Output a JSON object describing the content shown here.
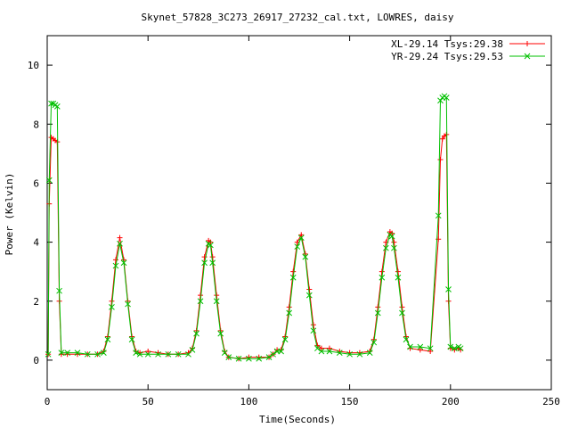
{
  "chart_data": {
    "type": "scatter",
    "title": "Skynet_57828_3C273_26917_27232_cal.txt, LOWRES, daisy",
    "xlabel": "Time(Seconds)",
    "ylabel": "Power (Kelvin)",
    "xlim": [
      0,
      250
    ],
    "ylim": [
      -1,
      11
    ],
    "xticks": [
      0,
      50,
      100,
      150,
      200,
      250
    ],
    "yticks": [
      0,
      2,
      4,
      6,
      8,
      10
    ],
    "grid": false,
    "legend_position": "top-right",
    "colors": {
      "XL": "#ff0000",
      "YR": "#00c000"
    },
    "series": [
      {
        "name": "XL-29.14 Tsys:29.38",
        "marker": "plus",
        "x": [
          0.5,
          1,
          2,
          3,
          4,
          5,
          6,
          7,
          10,
          15,
          20,
          25,
          28,
          30,
          32,
          34,
          36,
          38,
          40,
          42,
          44,
          46,
          50,
          55,
          60,
          65,
          70,
          72,
          74,
          76,
          78,
          80,
          81,
          82,
          84,
          86,
          88,
          90,
          95,
          100,
          105,
          110,
          112,
          114,
          116,
          118,
          120,
          122,
          124,
          126,
          128,
          130,
          132,
          134,
          136,
          140,
          145,
          150,
          155,
          160,
          162,
          164,
          166,
          168,
          170,
          171,
          172,
          174,
          176,
          178,
          180,
          185,
          190,
          194,
          195,
          196,
          197,
          198,
          199,
          200,
          202,
          204,
          205
        ],
        "y": [
          0.2,
          5.3,
          7.55,
          7.5,
          7.45,
          7.4,
          2.0,
          0.2,
          0.2,
          0.2,
          0.2,
          0.2,
          0.3,
          0.8,
          2.0,
          3.4,
          4.15,
          3.4,
          2.0,
          0.8,
          0.3,
          0.25,
          0.3,
          0.25,
          0.2,
          0.2,
          0.25,
          0.4,
          1.0,
          2.2,
          3.5,
          4.05,
          4.0,
          3.5,
          2.2,
          1.0,
          0.3,
          0.1,
          0.05,
          0.1,
          0.1,
          0.1,
          0.2,
          0.35,
          0.35,
          0.8,
          1.8,
          3.0,
          4.0,
          4.25,
          3.6,
          2.4,
          1.2,
          0.5,
          0.4,
          0.4,
          0.3,
          0.25,
          0.25,
          0.3,
          0.7,
          1.8,
          3.0,
          4.0,
          4.35,
          4.3,
          4.0,
          3.0,
          1.8,
          0.8,
          0.4,
          0.35,
          0.3,
          4.1,
          6.8,
          7.5,
          7.6,
          7.65,
          2.0,
          0.4,
          0.35,
          0.4,
          0.35
        ]
      },
      {
        "name": "YR-29.24 Tsys:29.53",
        "marker": "cross",
        "x": [
          0.5,
          1,
          2,
          3,
          4,
          5,
          6,
          7,
          10,
          15,
          20,
          25,
          28,
          30,
          32,
          34,
          36,
          38,
          40,
          42,
          44,
          46,
          50,
          55,
          60,
          65,
          70,
          72,
          74,
          76,
          78,
          80,
          81,
          82,
          84,
          86,
          88,
          90,
          95,
          100,
          105,
          110,
          112,
          114,
          116,
          118,
          120,
          122,
          124,
          126,
          128,
          130,
          132,
          134,
          136,
          140,
          145,
          150,
          155,
          160,
          162,
          164,
          166,
          168,
          170,
          171,
          172,
          174,
          176,
          178,
          180,
          185,
          190,
          194,
          195,
          196,
          197,
          198,
          199,
          200,
          202,
          204,
          205
        ],
        "y": [
          0.2,
          6.1,
          8.7,
          8.7,
          8.65,
          8.6,
          2.35,
          0.25,
          0.25,
          0.25,
          0.2,
          0.2,
          0.25,
          0.7,
          1.8,
          3.2,
          3.95,
          3.3,
          1.9,
          0.7,
          0.25,
          0.2,
          0.2,
          0.2,
          0.2,
          0.2,
          0.2,
          0.35,
          0.9,
          2.0,
          3.3,
          3.95,
          3.9,
          3.3,
          2.0,
          0.9,
          0.25,
          0.1,
          0.05,
          0.05,
          0.05,
          0.1,
          0.2,
          0.3,
          0.3,
          0.7,
          1.6,
          2.8,
          3.85,
          4.15,
          3.5,
          2.2,
          1.0,
          0.4,
          0.3,
          0.3,
          0.25,
          0.2,
          0.2,
          0.25,
          0.6,
          1.6,
          2.8,
          3.8,
          4.25,
          4.2,
          3.8,
          2.8,
          1.6,
          0.7,
          0.45,
          0.45,
          0.4,
          4.9,
          8.8,
          8.9,
          8.95,
          8.9,
          2.4,
          0.45,
          0.4,
          0.45,
          0.4
        ]
      }
    ]
  }
}
